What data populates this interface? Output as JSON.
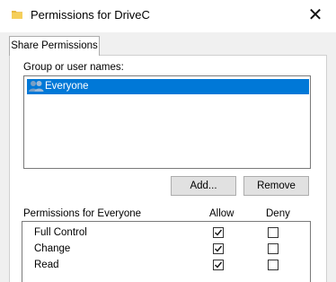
{
  "window": {
    "title": "Permissions for DriveC",
    "icons": {
      "title": "folder-icon",
      "close": "close-icon",
      "user": "users-group-icon"
    },
    "close_glyph": "✕"
  },
  "tabs": [
    {
      "label": "Share Permissions",
      "selected": true
    }
  ],
  "group_section": {
    "label": "Group or user names:",
    "items": [
      {
        "name": "Everyone",
        "selected": true
      }
    ]
  },
  "buttons": {
    "add": "Add...",
    "remove": "Remove"
  },
  "permissions": {
    "header": "Permissions for Everyone",
    "allow_header": "Allow",
    "deny_header": "Deny",
    "rows": [
      {
        "name": "Full Control",
        "allow": true,
        "deny": false
      },
      {
        "name": "Change",
        "allow": true,
        "deny": false
      },
      {
        "name": "Read",
        "allow": true,
        "deny": false
      }
    ]
  },
  "colors": {
    "selection": "#0078d7",
    "dialog_background": "#f0f0f0",
    "button_face": "#e1e1e1",
    "folder": "#e8b840"
  }
}
